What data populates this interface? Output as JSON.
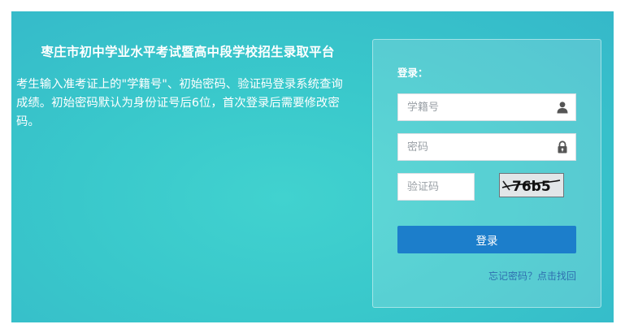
{
  "info": {
    "title": "枣庄市初中学业水平考试暨高中段学校招生录取平台",
    "description": "考生输入准考证上的\"学籍号\"、初始密码、验证码登录系统查询成绩。初始密码默认为身份证号后6位，首次登录后需要修改密码。"
  },
  "login": {
    "label": "登录：",
    "username_placeholder": "学籍号",
    "username_value": "",
    "password_placeholder": "密码",
    "password_value": "",
    "captcha_placeholder": "验证码",
    "captcha_value": "",
    "captcha_text": "76b5",
    "submit_label": "登录",
    "forgot_label": "忘记密码？点击找回"
  },
  "icons": {
    "username": "user-icon",
    "password": "lock-icon"
  },
  "colors": {
    "background": "#39c8cb",
    "button": "#1c7ecb",
    "link": "#2f6fb0"
  }
}
